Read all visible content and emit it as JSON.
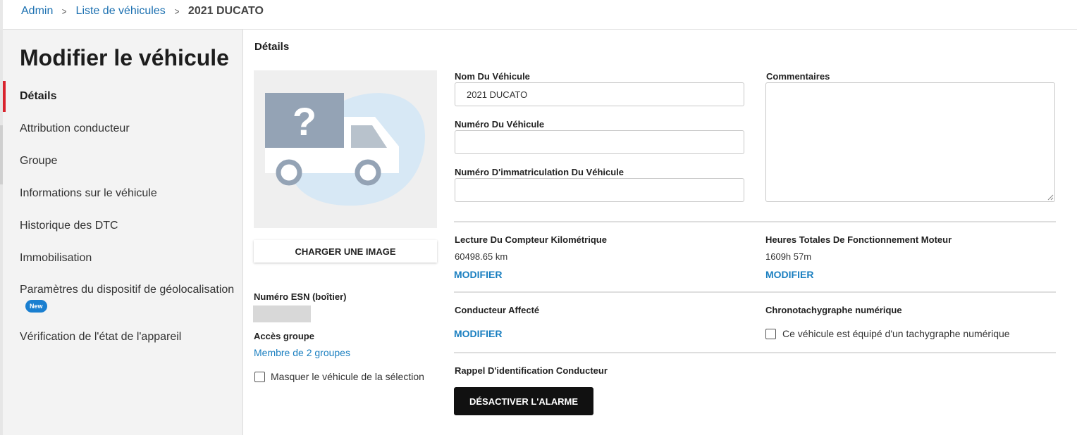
{
  "breadcrumb": {
    "items": [
      "Admin",
      "Liste de véhicules"
    ],
    "current": "2021 DUCATO"
  },
  "page_title": "Modifier le véhicule",
  "sidebar": {
    "items": [
      {
        "label": "Détails",
        "active": true
      },
      {
        "label": "Attribution conducteur"
      },
      {
        "label": "Groupe"
      },
      {
        "label": "Informations sur le véhicule"
      },
      {
        "label": "Historique des DTC"
      },
      {
        "label": "Immobilisation"
      },
      {
        "label": "Paramètres du dispositif de géolocalisation",
        "badge": "New"
      },
      {
        "label": "Vérification de l'état de l'appareil"
      }
    ]
  },
  "details": {
    "section_title": "Détails",
    "image": {
      "icon": "truck-question-icon",
      "upload_label": "CHARGER UNE IMAGE"
    },
    "esn_label": "Numéro ESN (boîtier)",
    "group_access_label": "Accès groupe",
    "group_access_link": "Membre de 2 groupes",
    "hide_vehicle_label": "Masquer le véhicule de la sélection",
    "vehicle_name_label": "Nom Du Véhicule",
    "vehicle_name_value": "2021 DUCATO",
    "vehicle_number_label": "Numéro Du Véhicule",
    "vehicle_number_value": "",
    "plate_label": "Numéro D'immatriculation Du Véhicule",
    "plate_value": "",
    "comments_label": "Commentaires",
    "odometer_label": "Lecture Du Compteur Kilométrique",
    "odometer_value": "60498.65 km",
    "engine_hours_label": "Heures Totales De Fonctionnement Moteur",
    "engine_hours_value": "1609h 57m",
    "modify_label": "MODIFIER",
    "driver_label": "Conducteur Affecté",
    "tachograph_label": "Chronotachygraphe numérique",
    "tachograph_checkbox_label": "Ce véhicule est équipé d'un tachygraphe numérique",
    "driver_id_reminder_label": "Rappel D'identification Conducteur",
    "disable_alarm_label": "DÉSACTIVER L'ALARME"
  },
  "colors": {
    "accent": "#1a7fc0",
    "active_marker": "#d9232d",
    "badge": "#1a7fd0",
    "truck_body": "#94a3b5",
    "blob": "#d7e8f5"
  }
}
